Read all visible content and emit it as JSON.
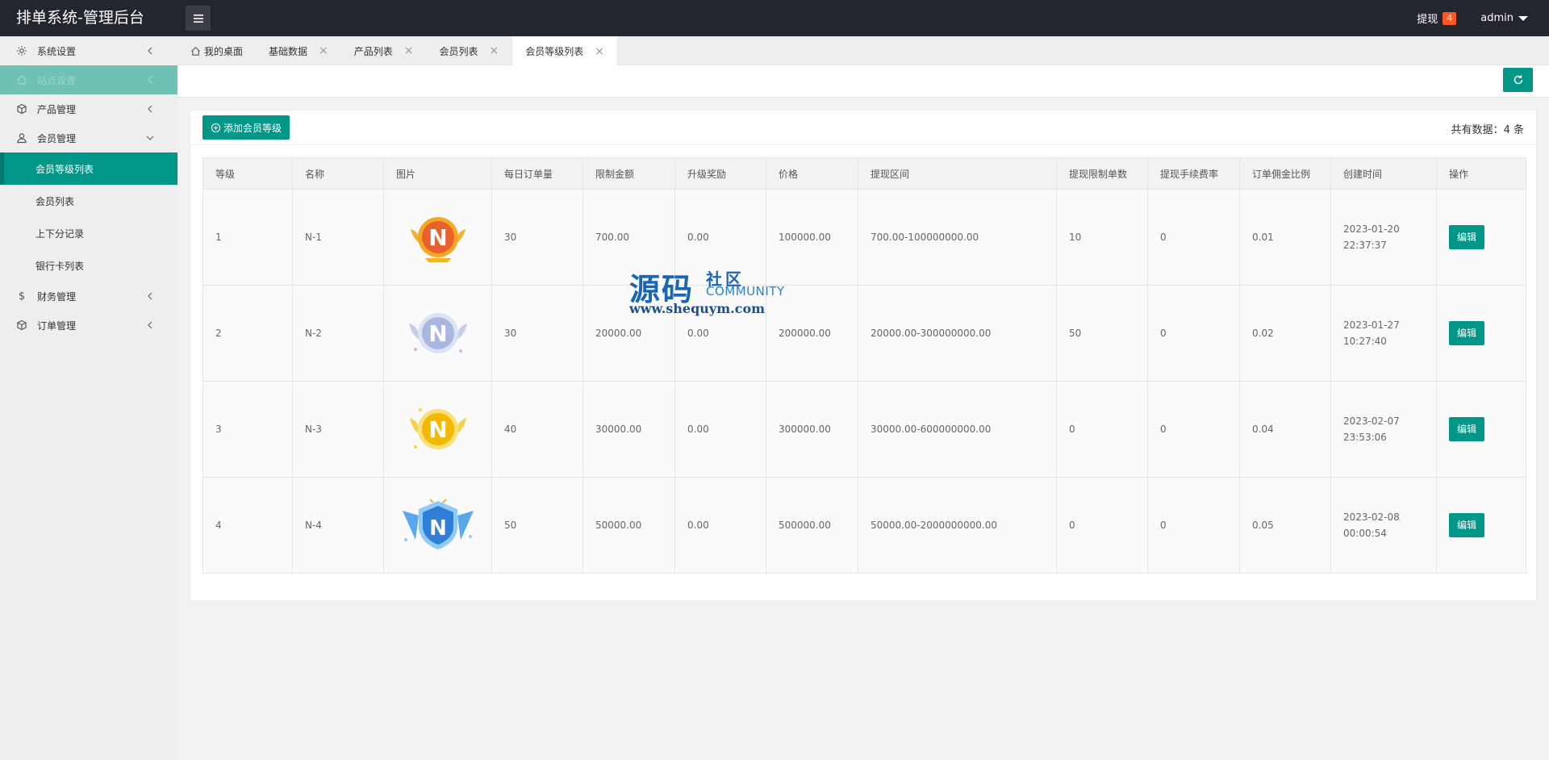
{
  "app": {
    "title": "排单系统-管理后台",
    "withdraw_label": "提现",
    "withdraw_count": "4",
    "user": "admin"
  },
  "sidebar": {
    "items": [
      {
        "label": "系统设置",
        "icon": "gear-icon"
      },
      {
        "label": "站点设置",
        "icon": "home-icon"
      },
      {
        "label": "产品管理",
        "icon": "box-icon"
      },
      {
        "label": "会员管理",
        "icon": "user-icon"
      },
      {
        "label": "财务管理",
        "icon": "dollar-icon"
      },
      {
        "label": "订单管理",
        "icon": "box-icon"
      }
    ],
    "member_sub": [
      "会员等级列表",
      "会员列表",
      "上下分记录",
      "银行卡列表"
    ]
  },
  "tabs": [
    {
      "label": "我的桌面"
    },
    {
      "label": "基础数据"
    },
    {
      "label": "产品列表"
    },
    {
      "label": "会员列表"
    },
    {
      "label": "会员等级列表"
    }
  ],
  "toolbar": {
    "add_label": "添加会员等级",
    "total_label": "共有数据：",
    "total_count": "4",
    "total_unit": "条"
  },
  "table": {
    "headers": [
      "等级",
      "名称",
      "图片",
      "每日订单量",
      "限制金额",
      "升级奖励",
      "价格",
      "提现区间",
      "提现限制单数",
      "提现手续费率",
      "订单佣金比例",
      "创建时间",
      "操作"
    ],
    "rows": [
      {
        "level": "1",
        "name": "N-1",
        "badge": "orange",
        "daily": "30",
        "limit": "700.00",
        "reward": "0.00",
        "price": "100000.00",
        "range": "700.00-100000000.00",
        "limit_count": "10",
        "fee": "0",
        "commission": "0.01",
        "time": "2023-01-20 22:37:37",
        "action": "编辑"
      },
      {
        "level": "2",
        "name": "N-2",
        "badge": "silver",
        "daily": "30",
        "limit": "20000.00",
        "reward": "0.00",
        "price": "200000.00",
        "range": "20000.00-300000000.00",
        "limit_count": "50",
        "fee": "0",
        "commission": "0.02",
        "time": "2023-01-27 10:27:40",
        "action": "编辑"
      },
      {
        "level": "3",
        "name": "N-3",
        "badge": "gold",
        "daily": "40",
        "limit": "30000.00",
        "reward": "0.00",
        "price": "300000.00",
        "range": "30000.00-600000000.00",
        "limit_count": "0",
        "fee": "0",
        "commission": "0.04",
        "time": "2023-02-07 23:53:06",
        "action": "编辑"
      },
      {
        "level": "4",
        "name": "N-4",
        "badge": "blue",
        "daily": "50",
        "limit": "50000.00",
        "reward": "0.00",
        "price": "500000.00",
        "range": "50000.00-2000000000.00",
        "limit_count": "0",
        "fee": "0",
        "commission": "0.05",
        "time": "2023-02-08 00:00:54",
        "action": "编辑"
      }
    ]
  },
  "watermark": {
    "cn": "源码",
    "cn2": "社区",
    "en": "COMMUNITY",
    "url": "www.shequym.com"
  },
  "colors": {
    "accent": "#009688",
    "header": "#23262e",
    "badge": "#ff5722"
  }
}
